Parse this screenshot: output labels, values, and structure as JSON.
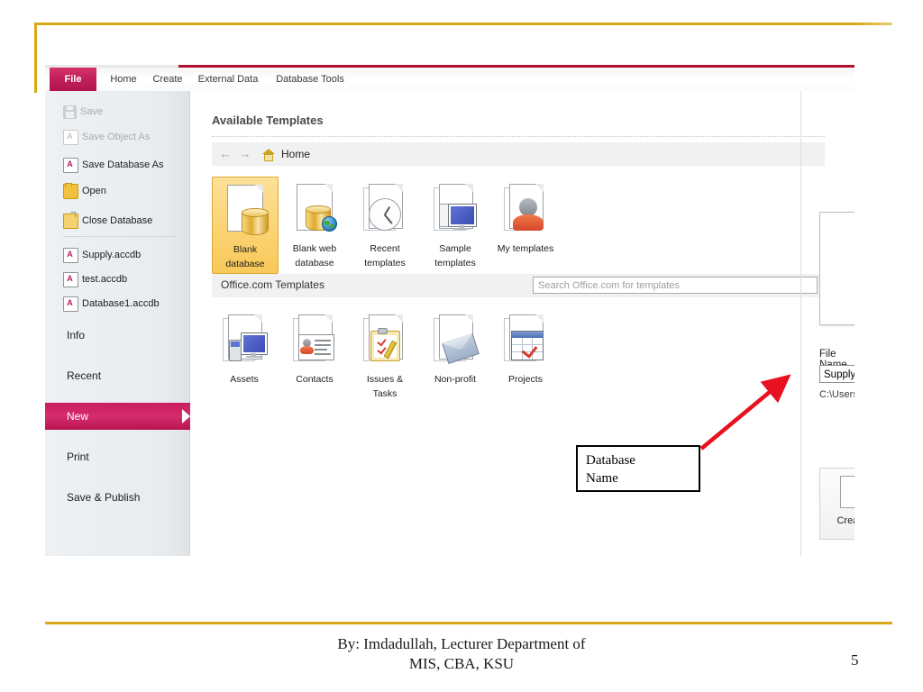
{
  "slide": {
    "footer_line1": "By: Imdadullah, Lecturer Department of",
    "footer_line2": "MIS, CBA, KSU",
    "page_number": "5",
    "accent_gold": "#d9a91c",
    "accent_crimson": "#c81d5f"
  },
  "ribbon": {
    "file_tab": "File",
    "tabs": [
      {
        "label": "Home"
      },
      {
        "label": "Create"
      },
      {
        "label": "External Data"
      },
      {
        "label": "Database Tools"
      }
    ]
  },
  "sidebar": {
    "commands": [
      {
        "label": "Save",
        "icon": "floppy-disk-icon",
        "disabled": true
      },
      {
        "label": "Save Object As",
        "icon": "save-object-icon",
        "disabled": true
      },
      {
        "label": "Save Database As",
        "icon": "access-file-icon",
        "disabled": false
      },
      {
        "label": "Open",
        "icon": "open-folder-icon",
        "disabled": false
      },
      {
        "label": "Close Database",
        "icon": "close-folder-icon",
        "disabled": false
      }
    ],
    "recent_files": [
      {
        "label": "Supply.accdb",
        "icon": "access-file-icon"
      },
      {
        "label": "test.accdb",
        "icon": "access-file-icon"
      },
      {
        "label": "Database1.accdb",
        "icon": "access-file-icon"
      }
    ],
    "nav": [
      {
        "label": "Info",
        "active": false
      },
      {
        "label": "Recent",
        "active": false
      },
      {
        "label": "New",
        "active": true
      },
      {
        "label": "Print",
        "active": false
      },
      {
        "label": "Save & Publish",
        "active": false
      }
    ]
  },
  "main": {
    "heading": "Available Templates",
    "breadcrumb": {
      "back_icon": "back-arrow-icon",
      "forward_icon": "forward-arrow-icon",
      "home_icon": "home-icon",
      "label": "Home"
    },
    "templates": [
      {
        "label_line1": "Blank",
        "label_line2": "database",
        "icon": "blank-database-icon",
        "selected": true
      },
      {
        "label_line1": "Blank web",
        "label_line2": "database",
        "icon": "blank-web-database-icon",
        "selected": false
      },
      {
        "label_line1": "Recent",
        "label_line2": "templates",
        "icon": "recent-templates-clock-icon",
        "selected": false
      },
      {
        "label_line1": "Sample",
        "label_line2": "templates",
        "icon": "sample-templates-monitor-icon",
        "selected": false
      },
      {
        "label_line1": "My templates",
        "label_line2": "",
        "icon": "my-templates-person-icon",
        "selected": false
      }
    ],
    "office_section": {
      "title": "Office.com Templates",
      "search_placeholder": "Search Office.com for templates",
      "search_value": ""
    },
    "office_templates": [
      {
        "label_line1": "Assets",
        "label_line2": "",
        "icon": "assets-icon"
      },
      {
        "label_line1": "Contacts",
        "label_line2": "",
        "icon": "contacts-icon"
      },
      {
        "label_line1": "Issues &",
        "label_line2": "Tasks",
        "icon": "issues-tasks-icon"
      },
      {
        "label_line1": "Non-profit",
        "label_line2": "",
        "icon": "non-profit-icon"
      },
      {
        "label_line1": "Projects",
        "label_line2": "",
        "icon": "projects-icon"
      }
    ]
  },
  "right_pane": {
    "file_name_label": "File Name",
    "file_name_value": "Supply",
    "path_value": "C:\\Users\\Jan\\Docu",
    "create_label": "Create",
    "create_icon": "blank-page-icon"
  },
  "annotation": {
    "callout_line1": "Database",
    "callout_line2": "Name",
    "arrow_color": "#e8111f"
  }
}
